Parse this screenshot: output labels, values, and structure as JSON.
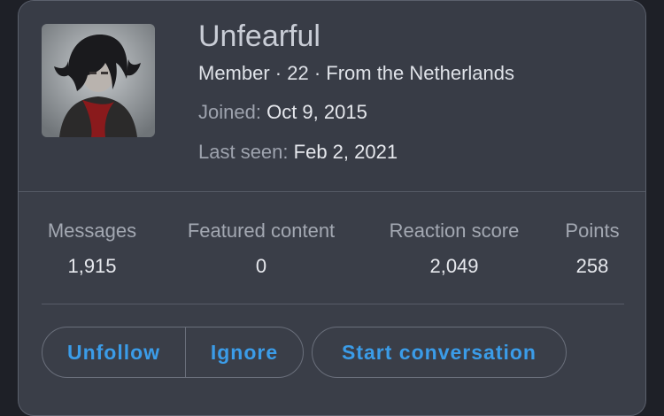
{
  "profile": {
    "username": "Unfearful",
    "meta": "Member · 22 · From the Netherlands",
    "joined_label": "Joined:",
    "joined_value": "Oct 9, 2015",
    "last_seen_label": "Last seen:",
    "last_seen_value": "Feb 2, 2021"
  },
  "stats": [
    {
      "label": "Messages",
      "value": "1,915"
    },
    {
      "label": "Featured content",
      "value": "0"
    },
    {
      "label": "Reaction score",
      "value": "2,049"
    },
    {
      "label": "Points",
      "value": "258"
    }
  ],
  "actions": {
    "unfollow": "Unfollow",
    "ignore": "Ignore",
    "start_conversation": "Start conversation"
  },
  "colors": {
    "card_background": "#3a3e48",
    "link_blue": "#3b9ce8",
    "text_primary": "#e6e8ed",
    "text_muted": "#9ea3ae"
  }
}
